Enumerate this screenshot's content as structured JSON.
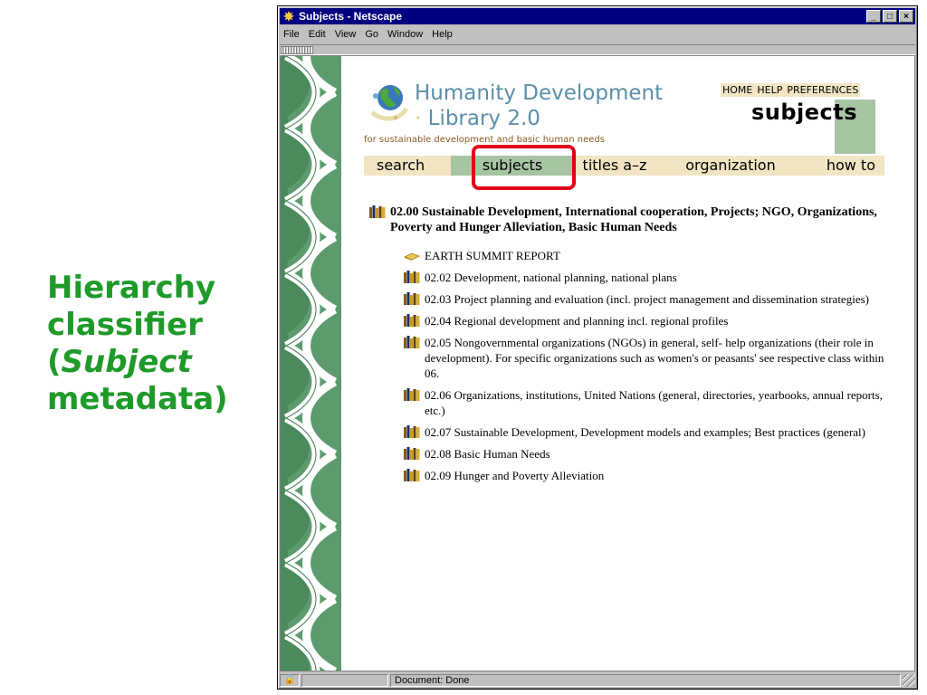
{
  "slide": {
    "caption_line1": "Hierarchy",
    "caption_line2": "classifier",
    "caption_open": "(",
    "caption_word": "Subject",
    "caption_line4": "metadata)",
    "caption_color": "#1f9a2a"
  },
  "window": {
    "title": "Subjects - Netscape",
    "app_icon": "netscape-icon",
    "buttons": {
      "minimize": "_",
      "maximize": "□",
      "close": "×"
    }
  },
  "menubar": {
    "items": [
      "File",
      "Edit",
      "View",
      "Go",
      "Window",
      "Help"
    ]
  },
  "library": {
    "title_line1": "Humanity Development",
    "title_line2": "Library 2.0",
    "tagline": "for sustainable development and basic human needs",
    "logo_icon": "globe-icon"
  },
  "toplinks": {
    "home": "HOME",
    "help": "HELP",
    "preferences": "PREFERENCES"
  },
  "page_heading": "subjects",
  "nav": {
    "tabs": [
      {
        "label": "search",
        "active": false
      },
      {
        "label": "subjects",
        "active": true
      },
      {
        "label": "titles a–z",
        "active": false
      },
      {
        "label": "organization",
        "active": false
      },
      {
        "label": "how to",
        "active": false
      }
    ]
  },
  "tree": {
    "top": {
      "icon": "bookshelf-icon",
      "label": "02.00 Sustainable Development, International cooperation, Projects; NGO, Organizations, Poverty and Hunger Alleviation, Basic Human Needs"
    },
    "children": [
      {
        "icon": "open-book-icon",
        "label": "EARTH SUMMIT REPORT"
      },
      {
        "icon": "bookshelf-icon",
        "label": "02.02 Development, national planning, national plans"
      },
      {
        "icon": "bookshelf-icon",
        "label": "02.03 Project planning and evaluation (incl. project management and dissemination strategies)"
      },
      {
        "icon": "bookshelf-icon",
        "label": "02.04 Regional development and planning incl. regional profiles"
      },
      {
        "icon": "bookshelf-icon",
        "label": "02.05 Nongovernmental organizations (NGOs) in general, self- help organizations (their role in development). For specific organizations such as women's or peasants' see respective class within 06."
      },
      {
        "icon": "bookshelf-icon",
        "label": "02.06 Organizations, institutions, United Nations (general, directories, yearbooks, annual reports, etc.)"
      },
      {
        "icon": "bookshelf-icon",
        "label": "02.07 Sustainable Development, Development models and examples; Best practices (general)"
      },
      {
        "icon": "bookshelf-icon",
        "label": "02.08 Basic Human Needs"
      },
      {
        "icon": "bookshelf-icon",
        "label": "02.09 Hunger and Poverty Alleviation"
      }
    ]
  },
  "statusbar": {
    "text": "Document: Done"
  },
  "colors": {
    "titlebar": "#000080",
    "tab_bg": "#f1e5c3",
    "tab_active": "#a7c4a3",
    "highlight": "#e2001a",
    "braid": "#5d9b6f"
  }
}
